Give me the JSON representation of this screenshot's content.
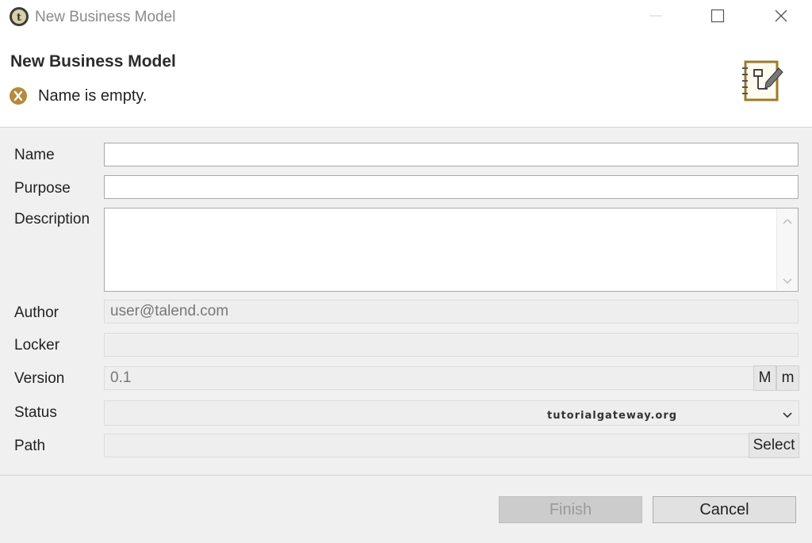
{
  "window": {
    "title": "New Business Model",
    "minimize_icon": "minimize-icon",
    "maximize_icon": "maximize-icon",
    "close_icon": "close-icon"
  },
  "banner": {
    "title": "New Business Model",
    "error_message": "Name is empty.",
    "error_icon": "error-icon",
    "wizard_icon": "notebook-pencil-icon"
  },
  "form": {
    "name_label": "Name",
    "name_value": "",
    "purpose_label": "Purpose",
    "purpose_value": "",
    "description_label": "Description",
    "description_value": "",
    "author_label": "Author",
    "author_value": "user@talend.com",
    "locker_label": "Locker",
    "locker_value": "",
    "version_label": "Version",
    "version_value": "0.1",
    "version_major_button": "M",
    "version_minor_button": "m",
    "status_label": "Status",
    "status_value": "",
    "path_label": "Path",
    "path_value": "",
    "path_select_button": "Select"
  },
  "watermark": "tutorialgateway.org",
  "footer": {
    "finish_label": "Finish",
    "cancel_label": "Cancel"
  },
  "colors": {
    "accent_gold": "#9c7a2e",
    "error_icon": "#b58a3c"
  }
}
